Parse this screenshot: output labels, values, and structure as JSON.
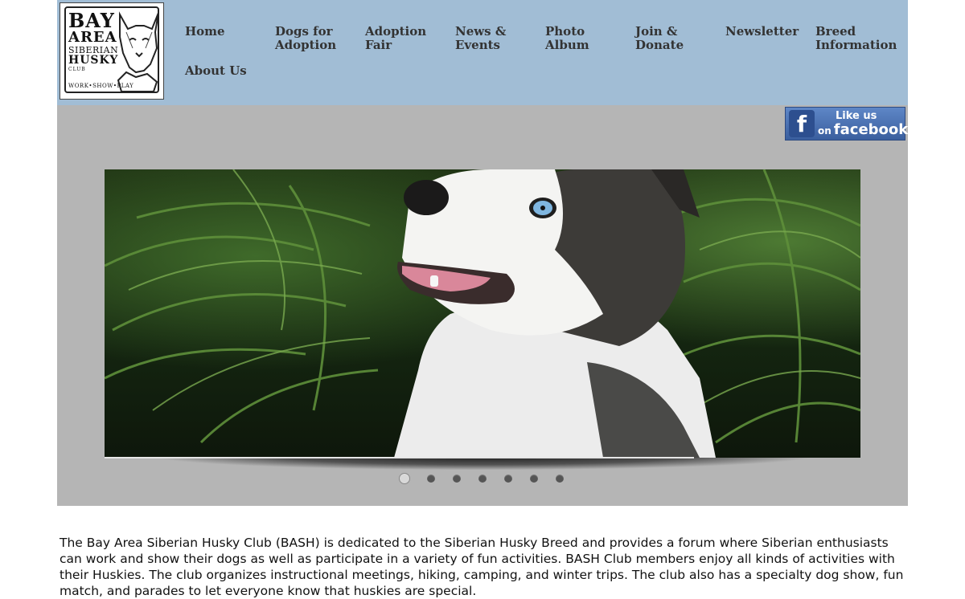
{
  "logo": {
    "line1": "BAY",
    "line2": "AREA",
    "line3": "SIBERIAN",
    "line4": "HUSKY",
    "line5": "CLUB",
    "tagline": "WORK•SHOW•PLAY"
  },
  "nav": {
    "items": [
      {
        "label": "Home"
      },
      {
        "label": "Dogs for\nAdoption"
      },
      {
        "label": "Adoption\nFair"
      },
      {
        "label": "News &\nEvents"
      },
      {
        "label": "Photo\nAlbum"
      },
      {
        "label": "Join &\nDonate"
      },
      {
        "label": "Newsletter"
      },
      {
        "label": "Breed\nInformation"
      },
      {
        "label": "About Us"
      }
    ]
  },
  "facebook": {
    "line1": "Like us",
    "line2_small": "on",
    "line2": "facebook",
    "icon": "facebook-f-icon"
  },
  "slideshow": {
    "slide_count": 7,
    "active_index": 0,
    "progress": 0.78
  },
  "intro": {
    "text": "The Bay Area Siberian Husky Club (BASH) is dedicated to the Siberian Husky Breed and provides a forum where Siberian enthusiasts can work and show their dogs as well as participate in a variety of fun activities. BASH Club members enjoy all kinds of activities with their Huskies. The club organizes instructional meetings, hiking, camping, and winter trips. The club also has a specialty dog show, fun match, and parades to let everyone know that huskies are special."
  },
  "colors": {
    "header_bg": "#a1bdd5",
    "banner_bg": "#b5b5b5",
    "nav_text": "#333333",
    "facebook_blue": "#3b5998"
  }
}
